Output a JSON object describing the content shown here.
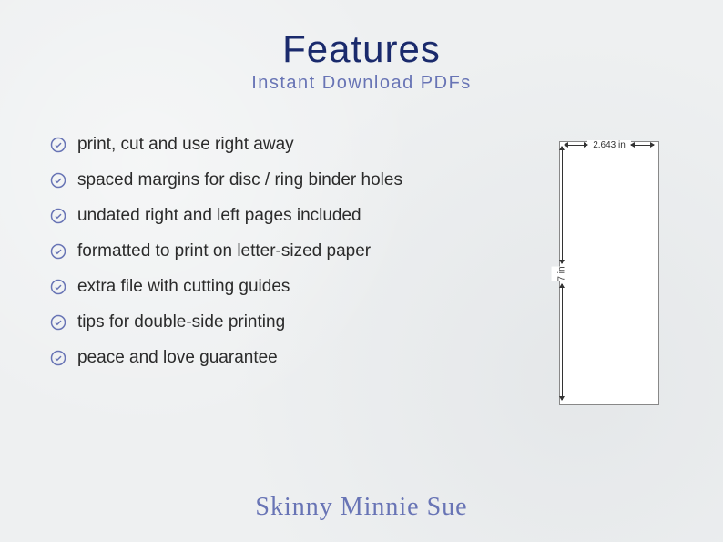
{
  "header": {
    "title": "Features",
    "subtitle": "Instant Download PDFs"
  },
  "features": [
    "print, cut and use right away",
    "spaced margins for disc / ring binder holes",
    "undated right and left pages included",
    "formatted to print on letter-sized paper",
    "extra file with cutting guides",
    "tips for double-side printing",
    "peace and love guarantee"
  ],
  "diagram": {
    "width_label": "2.643 in",
    "height_label": "7 in"
  },
  "signature": "Skinny Minnie Sue"
}
